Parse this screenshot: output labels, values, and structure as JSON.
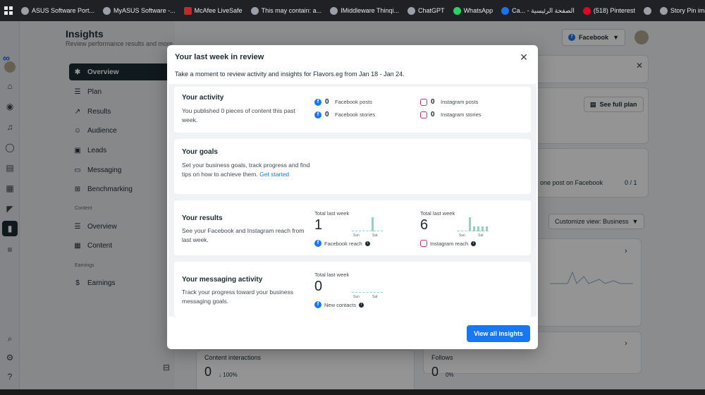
{
  "bookmarks": [
    {
      "label": "ASUS Software Port...",
      "icon": "globe-icon"
    },
    {
      "label": "MyASUS Software -...",
      "icon": "globe-icon"
    },
    {
      "label": "McAfee LiveSafe",
      "icon": "mcafee-icon"
    },
    {
      "label": "This may contain: a...",
      "icon": "globe-icon"
    },
    {
      "label": "IMiddleware Thinqi...",
      "icon": "globe-icon"
    },
    {
      "label": "ChatGPT",
      "icon": "chatgpt-icon"
    },
    {
      "label": "WhatsApp",
      "icon": "whatsapp-icon"
    },
    {
      "label": "Ca... - الصفحة الرئيسية",
      "icon": "canva-icon"
    },
    {
      "label": "(518) Pinterest",
      "icon": "pinterest-icon"
    },
    {
      "label": "",
      "icon": "globe-icon"
    },
    {
      "label": "Story Pin image",
      "icon": "globe-icon"
    }
  ],
  "header": {
    "title": "Insights",
    "subtitle": "Review performance results and more.",
    "account_selector": "Facebook"
  },
  "nav": {
    "items": [
      {
        "label": "Overview",
        "icon": "overview-icon",
        "active": true
      },
      {
        "label": "Plan",
        "icon": "plan-icon"
      },
      {
        "label": "Results",
        "icon": "results-icon"
      },
      {
        "label": "Audience",
        "icon": "audience-icon"
      },
      {
        "label": "Leads",
        "icon": "leads-icon"
      },
      {
        "label": "Messaging",
        "icon": "messaging-icon"
      },
      {
        "label": "Benchmarking",
        "icon": "benchmarking-icon"
      }
    ],
    "content_section": "Content",
    "content_items": [
      {
        "label": "Overview",
        "icon": "overview-icon"
      },
      {
        "label": "Content",
        "icon": "content-icon"
      }
    ],
    "earnings_section": "Earnings",
    "earnings_items": [
      {
        "label": "Earnings",
        "icon": "earnings-icon"
      }
    ]
  },
  "background": {
    "see_full_plan": "See full plan",
    "plan_task": "one post on Facebook",
    "plan_progress": "0 / 1",
    "customize_view": "Customize view: Business",
    "content_interactions_label": "Content interactions",
    "content_interactions_value": "0",
    "content_interactions_change": "↓ 100%",
    "follows_label": "Follows",
    "follows_value": "0",
    "follows_change": "0%"
  },
  "modal": {
    "title": "Your last week in review",
    "description": "Take a moment to review activity and insights for Flavors.eg from Jan 18 - Jan 24.",
    "activity": {
      "title": "Your activity",
      "desc": "You published 0 pieces of content this past week.",
      "stats": [
        {
          "value": "0",
          "label": "Facebook posts",
          "platform": "facebook"
        },
        {
          "value": "0",
          "label": "Instagram posts",
          "platform": "instagram"
        },
        {
          "value": "0",
          "label": "Facebook stories",
          "platform": "facebook"
        },
        {
          "value": "0",
          "label": "Instagram stories",
          "platform": "instagram"
        }
      ]
    },
    "goals": {
      "title": "Your goals",
      "desc": "Set your business goals, track progress and find tips on how to achieve them.",
      "link": "Get started"
    },
    "results": {
      "title": "Your results",
      "desc": "See your Facebook and Instagram reach from last week.",
      "facebook": {
        "caption": "Total last week",
        "value": "1",
        "label": "Facebook reach",
        "bars": [
          0,
          0,
          0,
          0,
          1,
          0,
          0
        ]
      },
      "instagram": {
        "caption": "Total last week",
        "value": "6",
        "label": "Instagram reach",
        "bars": [
          0,
          0,
          3,
          1,
          1,
          1,
          1
        ]
      },
      "axis_start": "Sun",
      "axis_end": "Sat"
    },
    "messaging": {
      "title": "Your messaging activity",
      "desc": "Track your progress toward your business messaging goals.",
      "caption": "Total last week",
      "value": "0",
      "label": "New contacts",
      "axis_start": "Sun",
      "axis_end": "Sat"
    },
    "cta": "View all insights"
  },
  "colors": {
    "accent": "#1877f2",
    "sparkline": "#8fd3c2",
    "dark_nav": "#1c2b33"
  }
}
